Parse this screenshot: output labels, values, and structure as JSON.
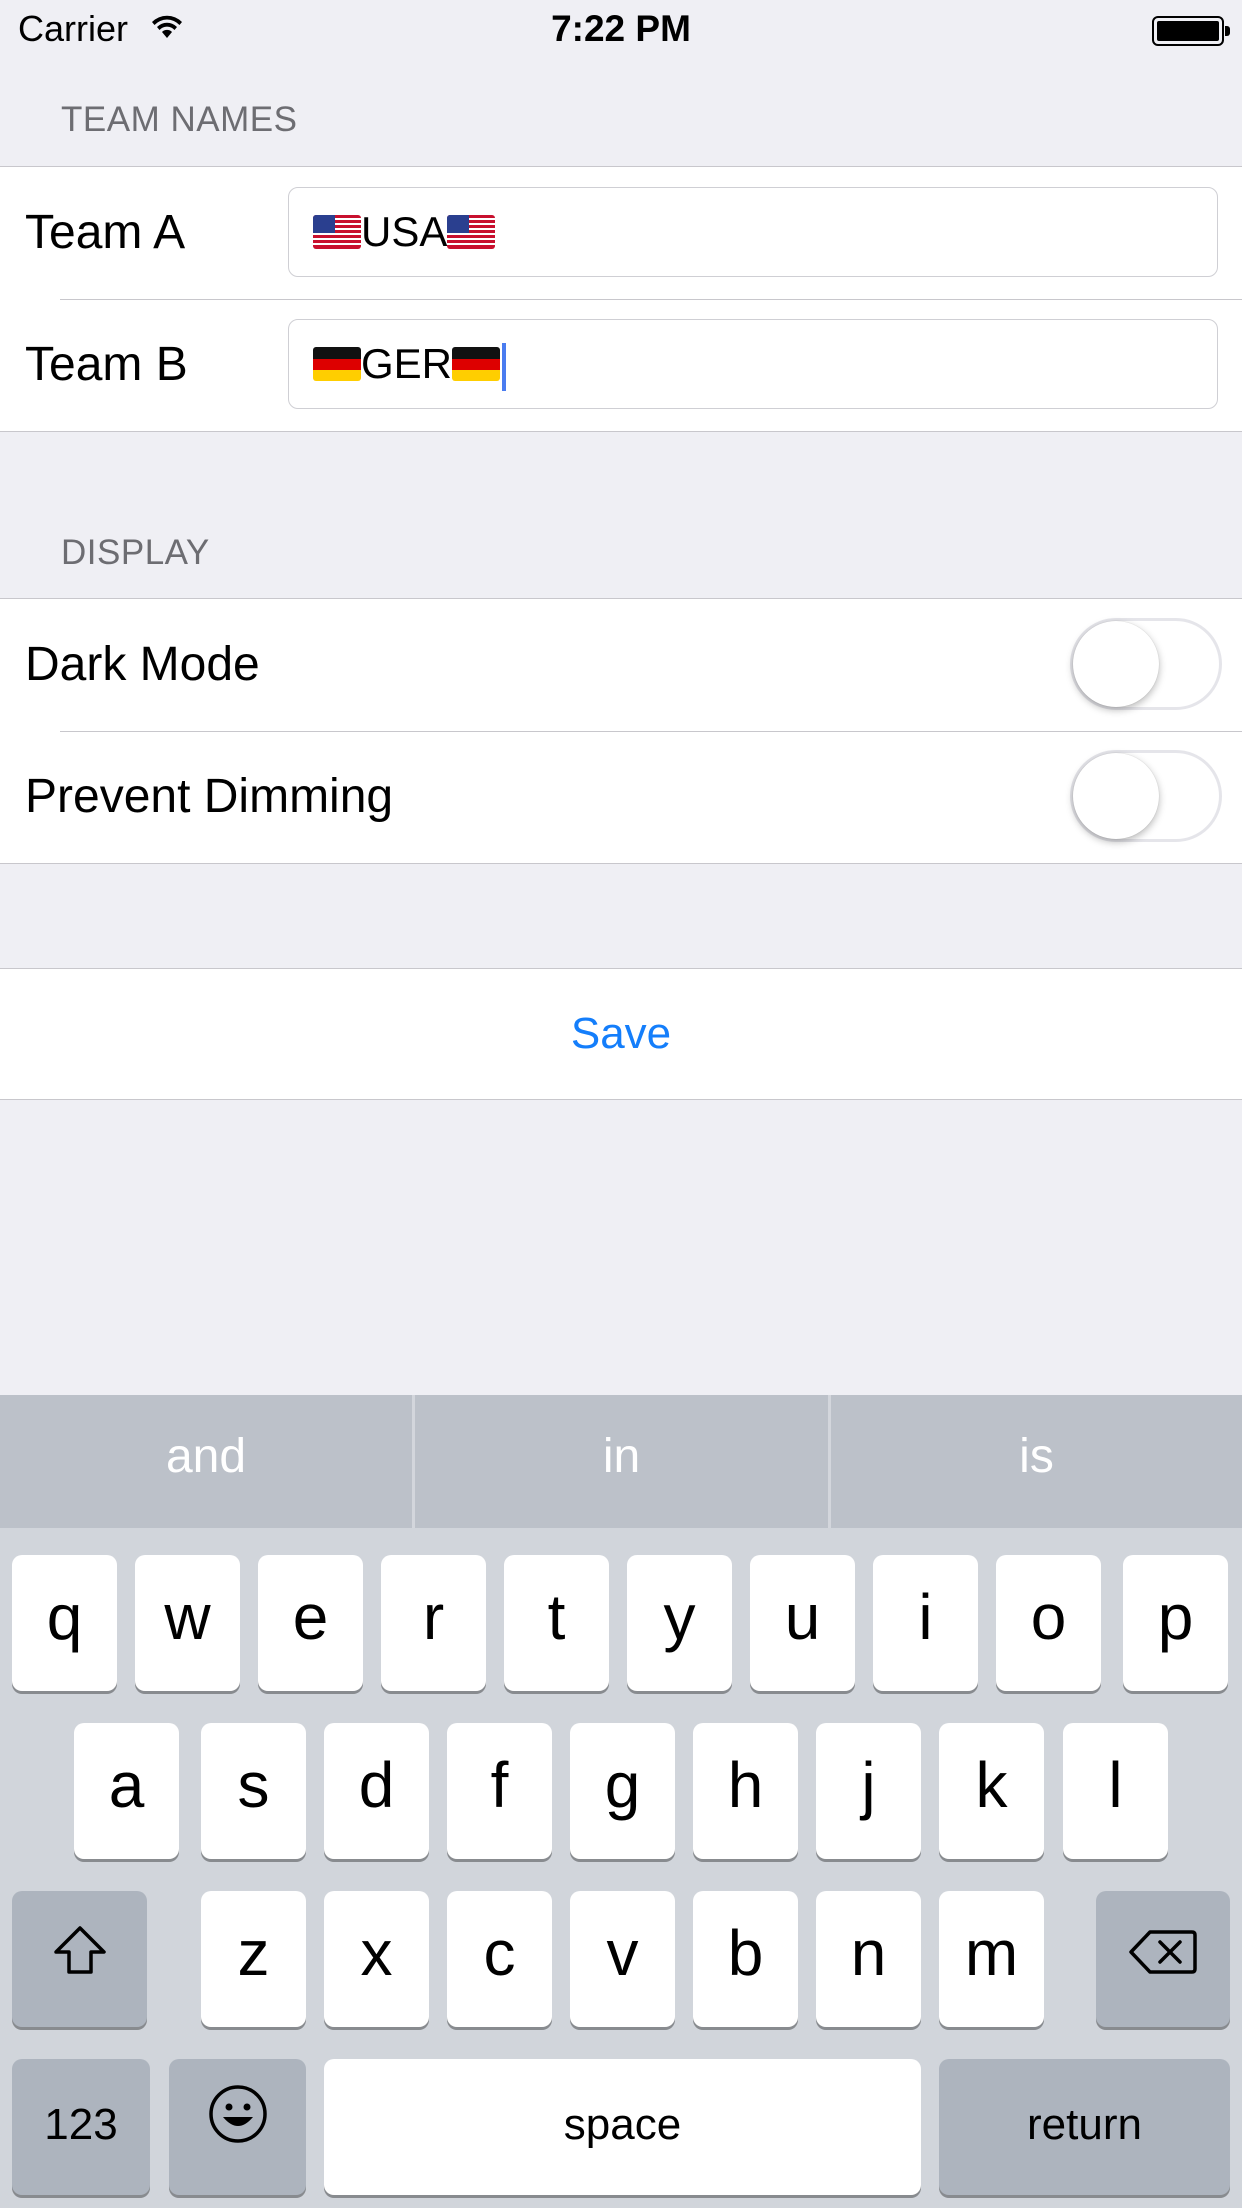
{
  "status_bar": {
    "carrier": "Carrier",
    "time": "7:22 PM"
  },
  "team_section": {
    "header": "TEAM NAMES",
    "team_a": {
      "label": "Team A",
      "value": "USA"
    },
    "team_b": {
      "label": "Team B",
      "value": "GER"
    }
  },
  "display_section": {
    "header": "DISPLAY",
    "dark_mode": {
      "label": "Dark Mode",
      "on": false
    },
    "prevent_dimming": {
      "label": "Prevent Dimming",
      "on": false
    }
  },
  "save_label": "Save",
  "keyboard": {
    "suggestions": [
      "and",
      "in",
      "is"
    ],
    "row1": [
      "q",
      "w",
      "e",
      "r",
      "t",
      "y",
      "u",
      "i",
      "o",
      "p"
    ],
    "row2": [
      "a",
      "s",
      "d",
      "f",
      "g",
      "h",
      "j",
      "k",
      "l"
    ],
    "row3": [
      "z",
      "x",
      "c",
      "v",
      "b",
      "n",
      "m"
    ],
    "numbers_label": "123",
    "space_label": "space",
    "return_label": "return"
  },
  "colors": {
    "accent": "#147efb",
    "background": "#efeff4",
    "cursor": "#4a7cf0"
  }
}
